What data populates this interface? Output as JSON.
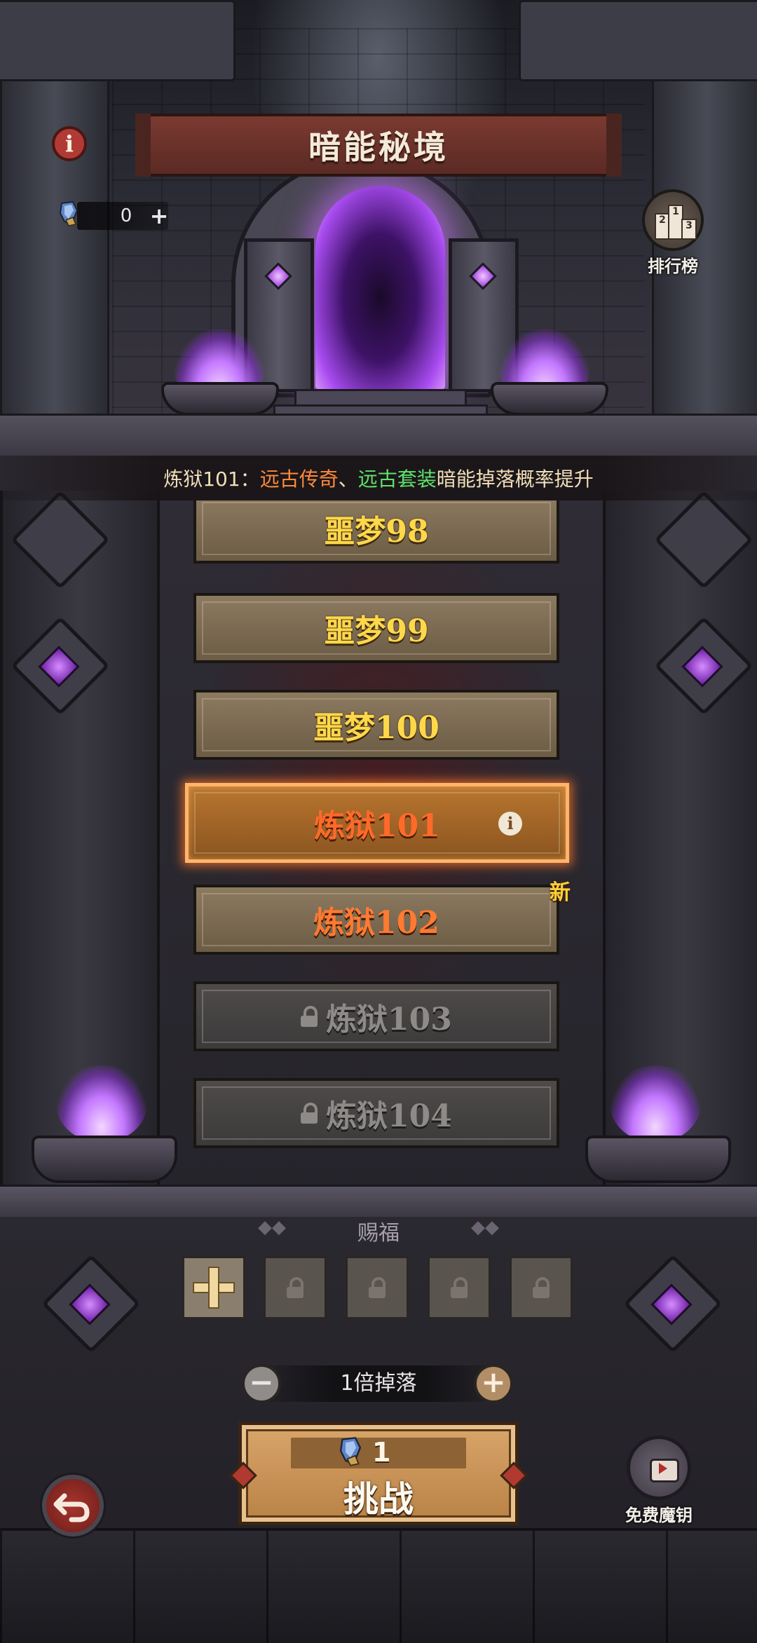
{
  "header": {
    "title": "暗能秘境",
    "key_count": "0"
  },
  "leaderboard": {
    "label": "排行榜",
    "podium": [
      "2",
      "1",
      "3"
    ]
  },
  "announcement": {
    "prefix": "炼狱101：",
    "item1": "远古传奇",
    "separator": "、",
    "item2": "远古套装",
    "suffix": "暗能掉落概率提升"
  },
  "levels": [
    {
      "label": "噩梦98",
      "state": "completed"
    },
    {
      "label": "噩梦99",
      "state": "completed"
    },
    {
      "label": "噩梦100",
      "state": "completed"
    },
    {
      "label": "炼狱101",
      "state": "selected"
    },
    {
      "label": "炼狱102",
      "state": "unlocked"
    },
    {
      "label": "炼狱103",
      "state": "locked"
    },
    {
      "label": "炼狱104",
      "state": "locked"
    }
  ],
  "new_badge": "新",
  "blessing": {
    "title": "赐福",
    "slots": [
      "add",
      "locked",
      "locked",
      "locked",
      "locked"
    ]
  },
  "multiplier": {
    "label": "1倍掉落"
  },
  "challenge": {
    "cost": "1",
    "label": "挑战"
  },
  "free_key": {
    "label": "免费魔钥"
  },
  "colors": {
    "announcement_highlight_orange": "#ff8a3c",
    "announcement_highlight_green": "#5ee36b",
    "level_completed_text": "#ffd84a",
    "level_selected_glow": "#ffb56a",
    "portal": "#a84bf0"
  }
}
